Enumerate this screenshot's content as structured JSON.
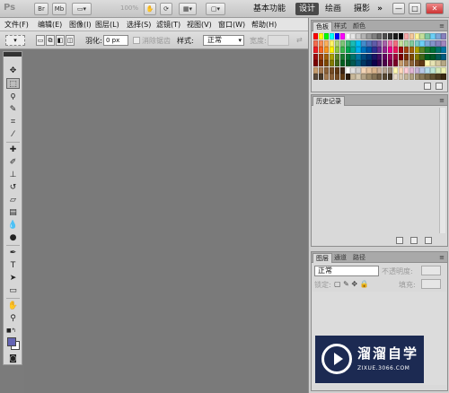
{
  "titlebar": {
    "logo": "Ps",
    "zoom": "100%",
    "workspaces": [
      "基本功能",
      "设计",
      "绘画",
      "摄影"
    ],
    "active_workspace": "设计",
    "more": "»",
    "window_controls": [
      "—",
      "□",
      "✕"
    ]
  },
  "menu": [
    "文件(F)",
    "编辑(E)",
    "图像(I)",
    "图层(L)",
    "选择(S)",
    "滤镜(T)",
    "视图(V)",
    "窗口(W)",
    "帮助(H)"
  ],
  "options": {
    "feather_label": "羽化:",
    "feather_value": "0 px",
    "antialias_label": "消除锯齿",
    "style_label": "样式:",
    "style_value": "正常",
    "width_label": "宽度:"
  },
  "swatch_panel": {
    "tabs": [
      "色板",
      "样式",
      "颜色"
    ],
    "active_tab": "色板"
  },
  "history_panel": {
    "tabs": [
      "历史记录"
    ],
    "active_tab": "历史记录"
  },
  "layers_panel": {
    "tabs": [
      "图层",
      "通道",
      "路径"
    ],
    "active_tab": "图层",
    "blend_mode": "正常",
    "opacity_label": "不透明度:",
    "lock_label": "锁定:",
    "fill_label": "填充:"
  },
  "watermark": {
    "title": "溜溜自学",
    "url": "ZIXUE.3066.COM"
  },
  "colors": {
    "foreground": "#6464b4",
    "background": "#ffffff",
    "accent": "#4a4a4a"
  }
}
